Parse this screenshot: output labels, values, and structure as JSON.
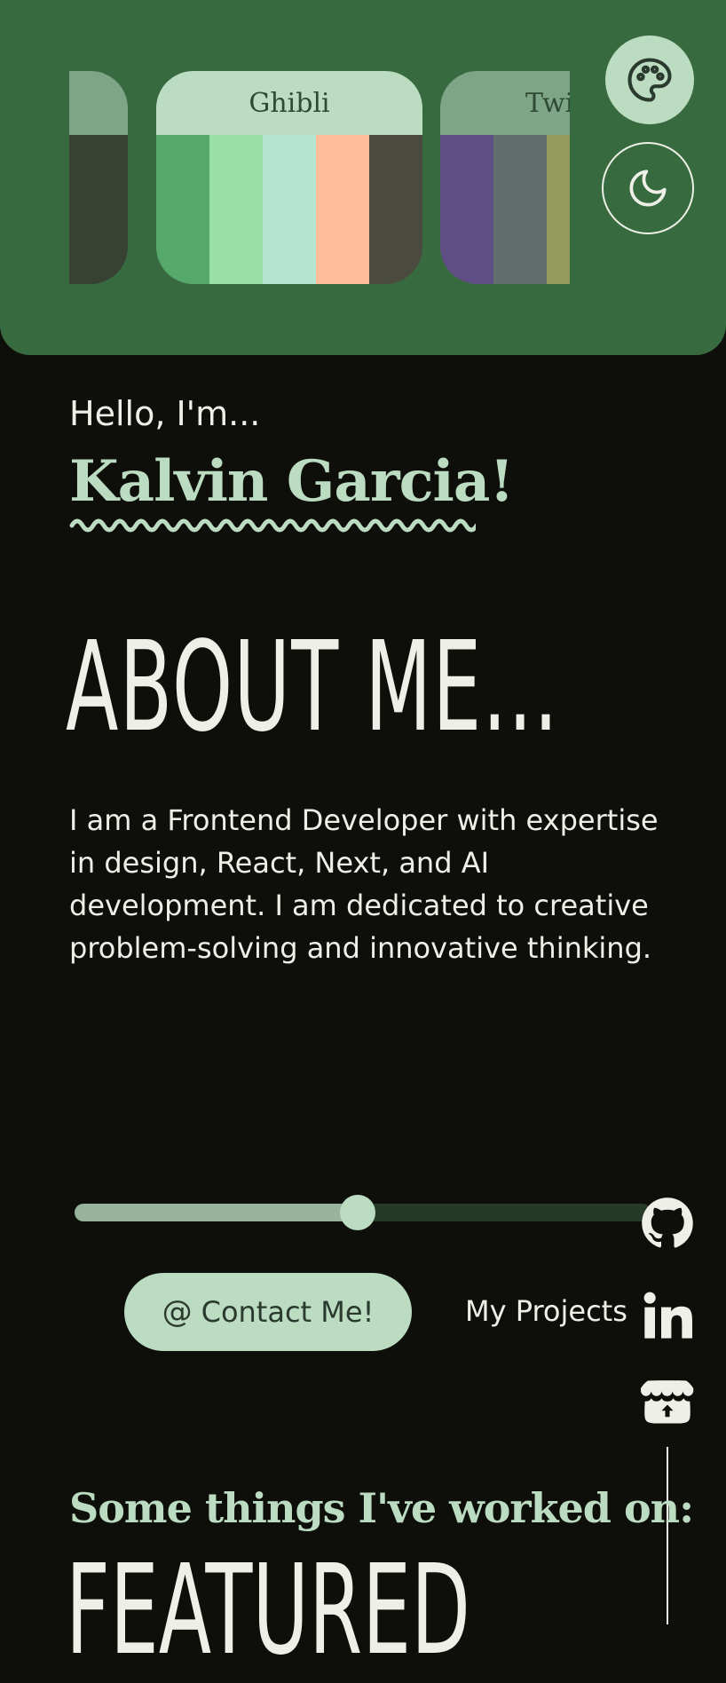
{
  "theme_palettes": [
    {
      "name": "",
      "title_bg": "#7ea586",
      "swatches": [
        "#6a5445",
        "#374234",
        "#374234"
      ],
      "clip": "left"
    },
    {
      "name": "Ghibli",
      "title_bg": "#bcdcc1",
      "swatches": [
        "#57a96b",
        "#9ce0a9",
        "#b4e5d2",
        "#ffbd9b",
        "#4b4a3e"
      ]
    },
    {
      "name": "Twi",
      "title_bg": "#7ea586",
      "swatches": [
        "#5f4e84",
        "#626e6b",
        "#939a5c"
      ],
      "clip": "right"
    }
  ],
  "header": {
    "theme_icon": "palette-icon",
    "dark_icon": "moon-icon"
  },
  "hero": {
    "greeting": "Hello, I'm...",
    "name": "Kalvin Garcia!"
  },
  "about": {
    "title": "ABOUT ME...",
    "text": "I am a Frontend Developer with expertise in design, React, Next, and AI development. I am dedicated to creative problem-solving and innovative thinking."
  },
  "slider": {
    "value": 0.49
  },
  "actions": {
    "contact_label": "Contact Me!",
    "contact_icon": "at-icon",
    "projects_label": "My Projects"
  },
  "social": [
    "github-icon",
    "linkedin-icon",
    "itch-icon"
  ],
  "featured": {
    "subtitle": "Some things I've worked on:",
    "title": "FEATURED"
  },
  "colors": {
    "accent": "#bcdcc1",
    "header_bg": "#386a3f",
    "page_bg": "#0e0f0b"
  }
}
